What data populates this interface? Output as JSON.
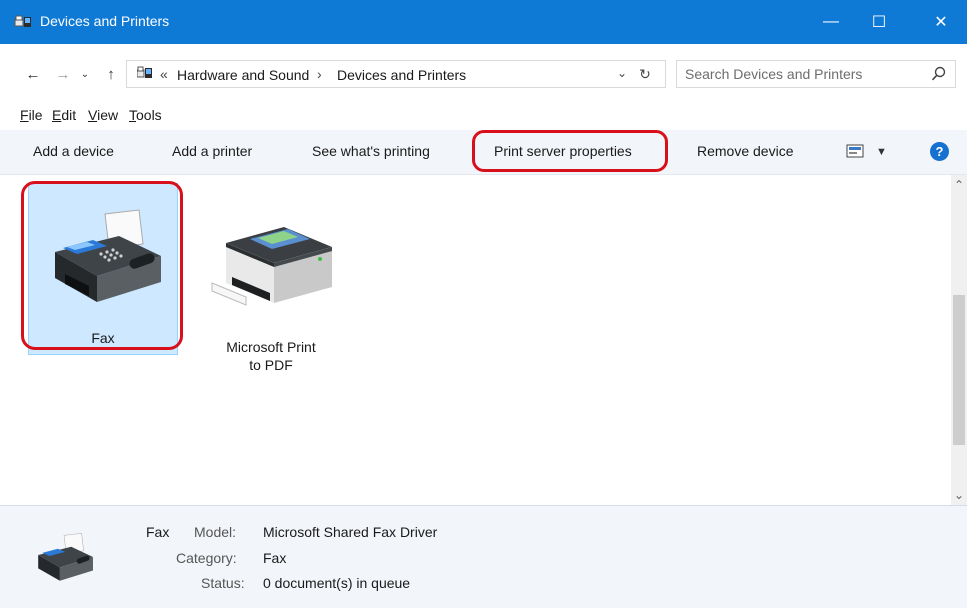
{
  "window": {
    "title": "Devices and Printers",
    "minimize_glyph": "—",
    "maximize_glyph": "☐",
    "close_glyph": "✕"
  },
  "nav": {
    "back_glyph": "←",
    "forward_glyph": "→",
    "recent_glyph": "⌄",
    "up_glyph": "↑"
  },
  "address": {
    "overflow": "«",
    "crumbs": [
      "Hardware and Sound",
      "Devices and Printers"
    ],
    "separator": "›",
    "dropdown_glyph": "⌄",
    "refresh_glyph": "↻"
  },
  "search": {
    "placeholder": "Search Devices and Printers"
  },
  "menu": [
    {
      "label": "File",
      "accel": "F",
      "rest": "ile"
    },
    {
      "label": "Edit",
      "accel": "E",
      "rest": "dit"
    },
    {
      "label": "View",
      "accel": "V",
      "rest": "iew"
    },
    {
      "label": "Tools",
      "accel": "T",
      "rest": "ools"
    }
  ],
  "commands": [
    "Add a device",
    "Add a printer",
    "See what's printing",
    "Print server properties",
    "Remove device"
  ],
  "command_bar": {
    "view_drop_glyph": "▼",
    "help_glyph": "?"
  },
  "devices": [
    {
      "name": "Fax",
      "icon": "fax-icon",
      "selected": true
    },
    {
      "name": "Microsoft Print to PDF",
      "name_line1": "Microsoft Print",
      "name_line2": "to PDF",
      "icon": "printer-icon",
      "selected": false
    }
  ],
  "scrollbar": {
    "up_glyph": "⌃",
    "down_glyph": "⌄"
  },
  "details": {
    "name": "Fax",
    "model_label": "Model:",
    "model_value": "Microsoft Shared Fax Driver",
    "category_label": "Category:",
    "category_value": "Fax",
    "status_label": "Status:",
    "status_value": "0 document(s) in queue"
  },
  "colors": {
    "titlebar": "#0f7ad6",
    "selection": "#cde8ff",
    "highlight": "#d8101b",
    "help": "#1670cf"
  }
}
